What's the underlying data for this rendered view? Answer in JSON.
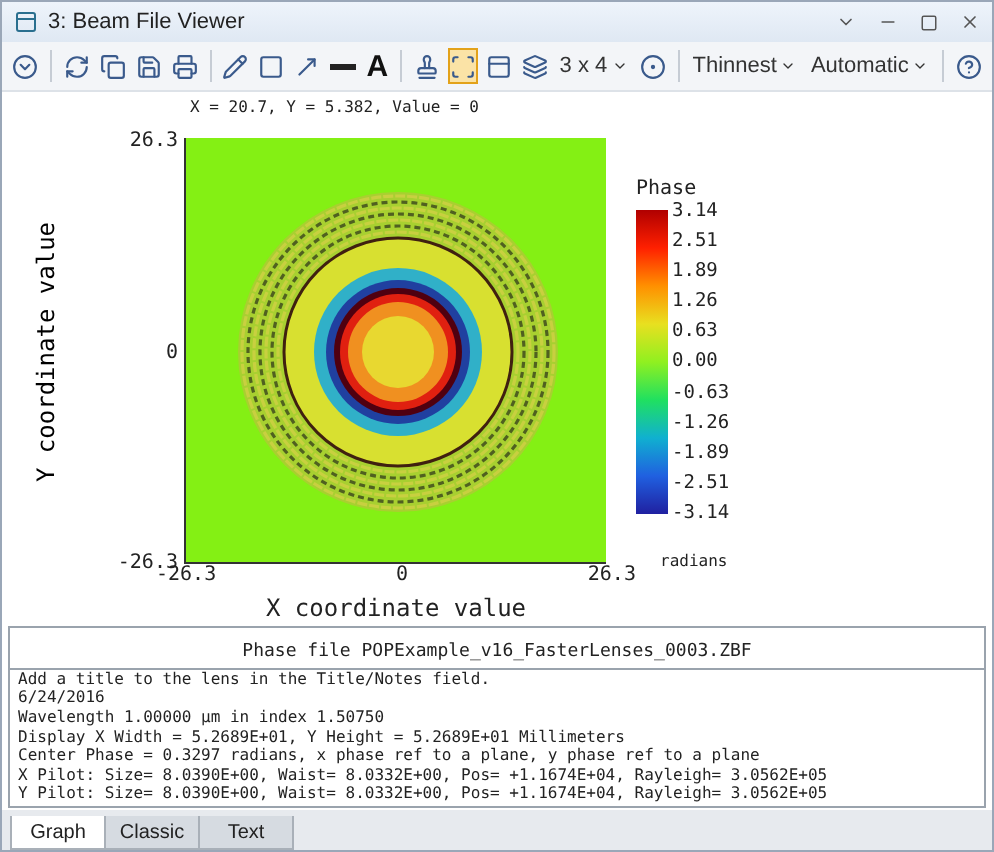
{
  "window": {
    "title": "3: Beam File Viewer"
  },
  "toolbar": [
    {
      "kind": "button",
      "selected": false
    },
    {
      "kind": "separator"
    },
    {
      "kind": "button",
      "selected": false
    },
    {
      "kind": "button",
      "selected": false
    },
    {
      "kind": "button",
      "selected": false
    },
    {
      "kind": "button",
      "selected": false
    },
    {
      "kind": "separator"
    },
    {
      "kind": "button",
      "selected": false
    },
    {
      "kind": "button",
      "selected": false
    },
    {
      "kind": "button",
      "selected": false
    },
    {
      "kind": "button",
      "selected": false
    },
    {
      "kind": "text",
      "label": "A"
    },
    {
      "kind": "separator"
    },
    {
      "kind": "button",
      "selected": false
    },
    {
      "kind": "button",
      "selected": true
    },
    {
      "kind": "button",
      "selected": false
    },
    {
      "kind": "button",
      "selected": false
    },
    {
      "kind": "dropdown",
      "label": "3 x 4"
    },
    {
      "kind": "button",
      "selected": false
    },
    {
      "kind": "separator"
    },
    {
      "kind": "dropdown",
      "label": "Thinnest"
    },
    {
      "kind": "dropdown",
      "label": "Automatic"
    },
    {
      "kind": "separator"
    },
    {
      "kind": "button",
      "selected": false
    }
  ],
  "readout": "X = 20.7, Y = 5.382, Value = 0",
  "plot": {
    "xlabel": "X coordinate value",
    "ylabel": "Y coordinate value",
    "xticks": [
      "-26.3",
      "0",
      "26.3"
    ],
    "yticks": [
      "26.3",
      "0",
      "-26.3"
    ]
  },
  "colorbar": {
    "title": "Phase",
    "ticks": [
      "3.14",
      "2.51",
      "1.89",
      "1.26",
      "0.63",
      "0.00",
      "-0.63",
      "-1.26",
      "-1.89",
      "-2.51",
      "-3.14"
    ],
    "unit": "radians"
  },
  "info": {
    "title": "Phase file POPExample_v16_FasterLenses_0003.ZBF",
    "lines": [
      "Add a title to the lens in the Title/Notes field.",
      "6/24/2016",
      "Wavelength 1.00000 µm in index 1.50750",
      "Display X Width = 5.2689E+01, Y Height = 5.2689E+01 Millimeters",
      "Center Phase = 0.3297 radians, x phase ref to a plane, y phase ref to a plane",
      "X Pilot: Size= 8.0390E+00, Waist= 8.0332E+00, Pos= +1.1674E+04, Rayleigh= 3.0562E+05",
      "Y Pilot: Size= 8.0390E+00, Waist= 8.0332E+00, Pos= +1.1674E+04, Rayleigh= 3.0562E+05"
    ]
  },
  "tabs": [
    {
      "label": "Graph",
      "selected": true
    },
    {
      "label": "Classic",
      "selected": false
    },
    {
      "label": "Text",
      "selected": false
    }
  ]
}
